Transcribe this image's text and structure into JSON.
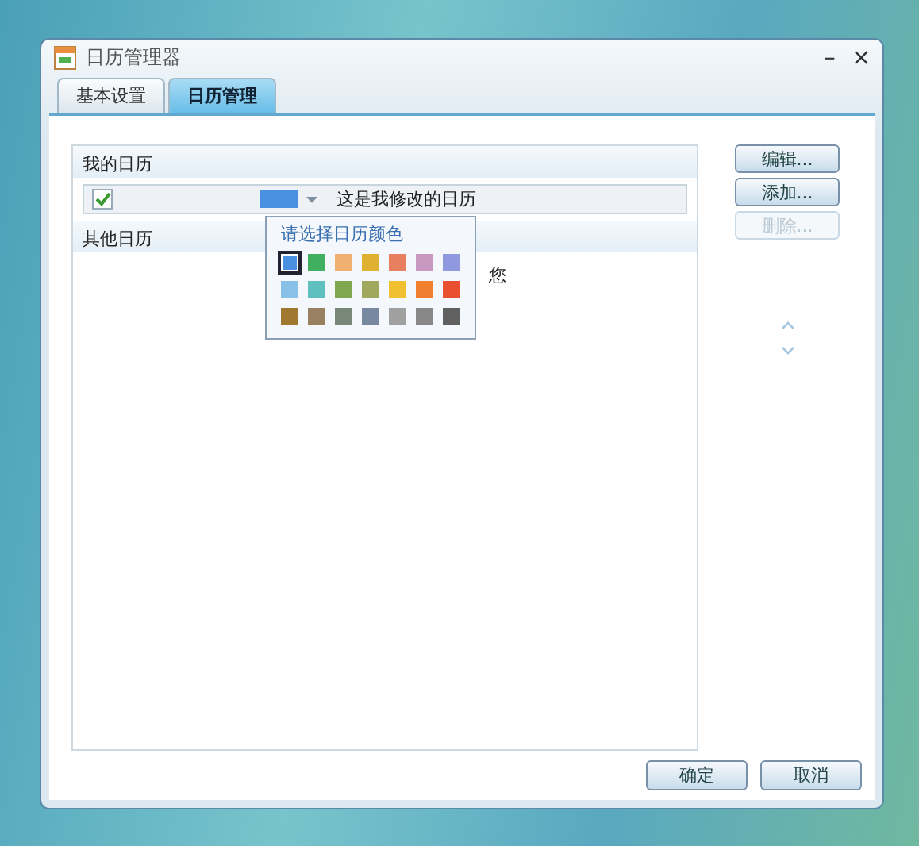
{
  "window": {
    "title": "日历管理器",
    "minimize": "–",
    "close": "×"
  },
  "tabs": [
    {
      "label": "基本设置",
      "selected": false
    },
    {
      "label": "日历管理",
      "selected": true
    }
  ],
  "my_calendars": {
    "header": "我的日历",
    "rows": [
      {
        "checked": true,
        "color": "#4a90e0",
        "name": "这是我修改的日历"
      }
    ]
  },
  "other_calendars": {
    "header": "其他日历",
    "rows": [
      {
        "text": "您"
      }
    ]
  },
  "color_picker": {
    "title": "请选择日历颜色",
    "swatches": [
      {
        "color": "#4a90e0",
        "selected": true
      },
      {
        "color": "#40b060",
        "selected": false
      },
      {
        "color": "#f0b070",
        "selected": false
      },
      {
        "color": "#e0b030",
        "selected": false
      },
      {
        "color": "#e88060",
        "selected": false
      },
      {
        "color": "#c898c0",
        "selected": false
      },
      {
        "color": "#9098e0",
        "selected": false
      },
      {
        "color": "#88c0e8",
        "selected": false
      },
      {
        "color": "#60c0c0",
        "selected": false
      },
      {
        "color": "#80a850",
        "selected": false
      },
      {
        "color": "#a0a860",
        "selected": false
      },
      {
        "color": "#f0c030",
        "selected": false
      },
      {
        "color": "#f08030",
        "selected": false
      },
      {
        "color": "#e85030",
        "selected": false
      },
      {
        "color": "#a07830",
        "selected": false
      },
      {
        "color": "#988060",
        "selected": false
      },
      {
        "color": "#788878",
        "selected": false
      },
      {
        "color": "#7888a0",
        "selected": false
      },
      {
        "color": "#a0a0a0",
        "selected": false
      },
      {
        "color": "#888888",
        "selected": false
      },
      {
        "color": "#606060",
        "selected": false
      }
    ]
  },
  "side_buttons": [
    {
      "label": "编辑...",
      "disabled": false
    },
    {
      "label": "添加...",
      "disabled": false
    },
    {
      "label": "删除...",
      "disabled": true
    }
  ],
  "footer_buttons": [
    "确定",
    "取消"
  ]
}
